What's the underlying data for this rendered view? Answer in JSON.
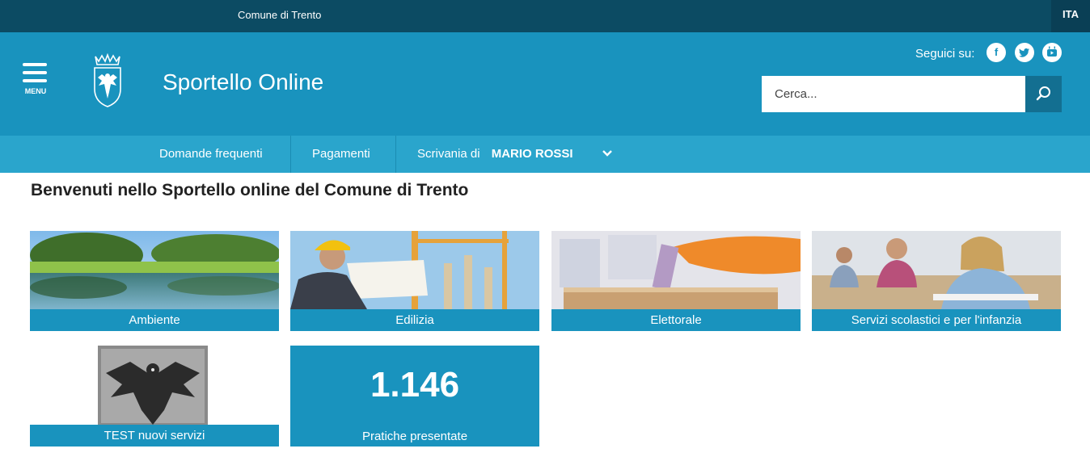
{
  "topbar": {
    "site_name": "Comune di Trento",
    "language": "ITA"
  },
  "header": {
    "menu_label": "MENU",
    "title": "Sportello Online",
    "follow_label": "Seguici su:",
    "social": [
      "facebook-icon",
      "twitter-icon",
      "youtube-icon"
    ],
    "search_placeholder": "Cerca..."
  },
  "nav": {
    "faq": "Domande frequenti",
    "payments": "Pagamenti",
    "desk_label": "Scrivania di",
    "user_name": "MARIO ROSSI"
  },
  "main": {
    "welcome": "Benvenuti nello Sportello online del Comune di Trento",
    "tiles": [
      {
        "label": "Ambiente"
      },
      {
        "label": "Edilizia"
      },
      {
        "label": "Elettorale"
      },
      {
        "label": "Servizi scolastici e per l'infanzia"
      },
      {
        "label": "TEST nuovi servizi"
      }
    ],
    "stat": {
      "value": "1.146",
      "label": "Pratiche presentate"
    }
  },
  "colors": {
    "primary": "#1993be",
    "dark": "#0c4b63",
    "nav": "#2aa5cc"
  }
}
